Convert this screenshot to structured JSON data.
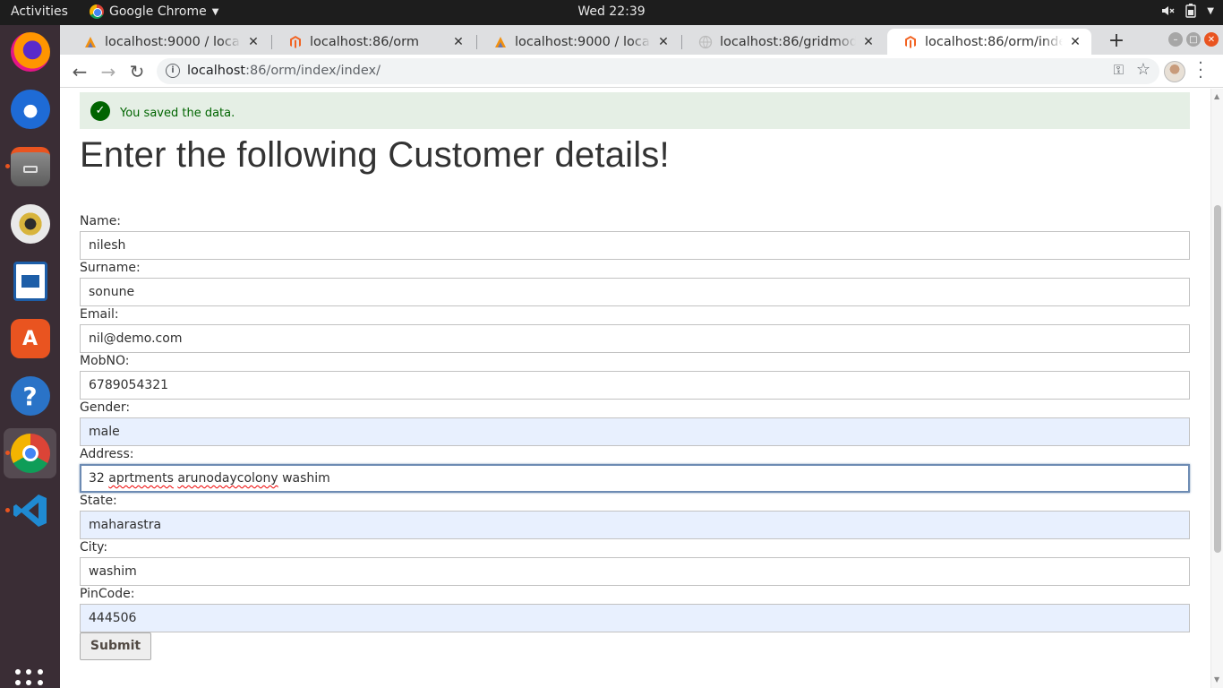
{
  "topbar": {
    "activities": "Activities",
    "app_name": "Google Chrome",
    "clock": "Wed 22:39"
  },
  "dock": {
    "items": [
      "firefox",
      "thunderbird",
      "files",
      "rhythmbox",
      "libreoffice-writer",
      "ubuntu-software",
      "help",
      "google-chrome",
      "vscode"
    ]
  },
  "tabs": [
    {
      "title": "localhost:9000 / localhost",
      "icon": "phpmyadmin-icon"
    },
    {
      "title": "localhost:86/orm",
      "icon": "magento-icon"
    },
    {
      "title": "localhost:9000 / localhost",
      "icon": "phpmyadmin-icon"
    },
    {
      "title": "localhost:86/gridmodule",
      "icon": "globe-icon"
    },
    {
      "title": "localhost:86/orm/index/index/",
      "icon": "magento-icon",
      "active": true
    }
  ],
  "address_bar": {
    "host": "localhost",
    "path": ":86/orm/index/index/"
  },
  "message": {
    "text": "You saved the data."
  },
  "form": {
    "title": "Enter the following Customer details!",
    "fields": [
      {
        "label": "Name:",
        "value": "nilesh"
      },
      {
        "label": "Surname:",
        "value": "sonune"
      },
      {
        "label": "Email:",
        "value": "nil@demo.com"
      },
      {
        "label": "MobNO:",
        "value": "6789054321"
      },
      {
        "label": "Gender:",
        "value": "male"
      },
      {
        "label": "Address:",
        "value_parts": [
          "32 ",
          "aprtments",
          " ",
          "arunodaycolony",
          " washim"
        ]
      },
      {
        "label": "State:",
        "value": "maharastra"
      },
      {
        "label": "City:",
        "value": "washim"
      },
      {
        "label": "PinCode:",
        "value": "444506"
      }
    ],
    "submit_label": "Submit"
  },
  "colors": {
    "success_bg": "#e5efe5",
    "success_text": "#006400",
    "autofill_bg": "#e8f0fe",
    "dock_bg": "#3a2d35",
    "tabstrip_bg": "#dedfe1"
  }
}
